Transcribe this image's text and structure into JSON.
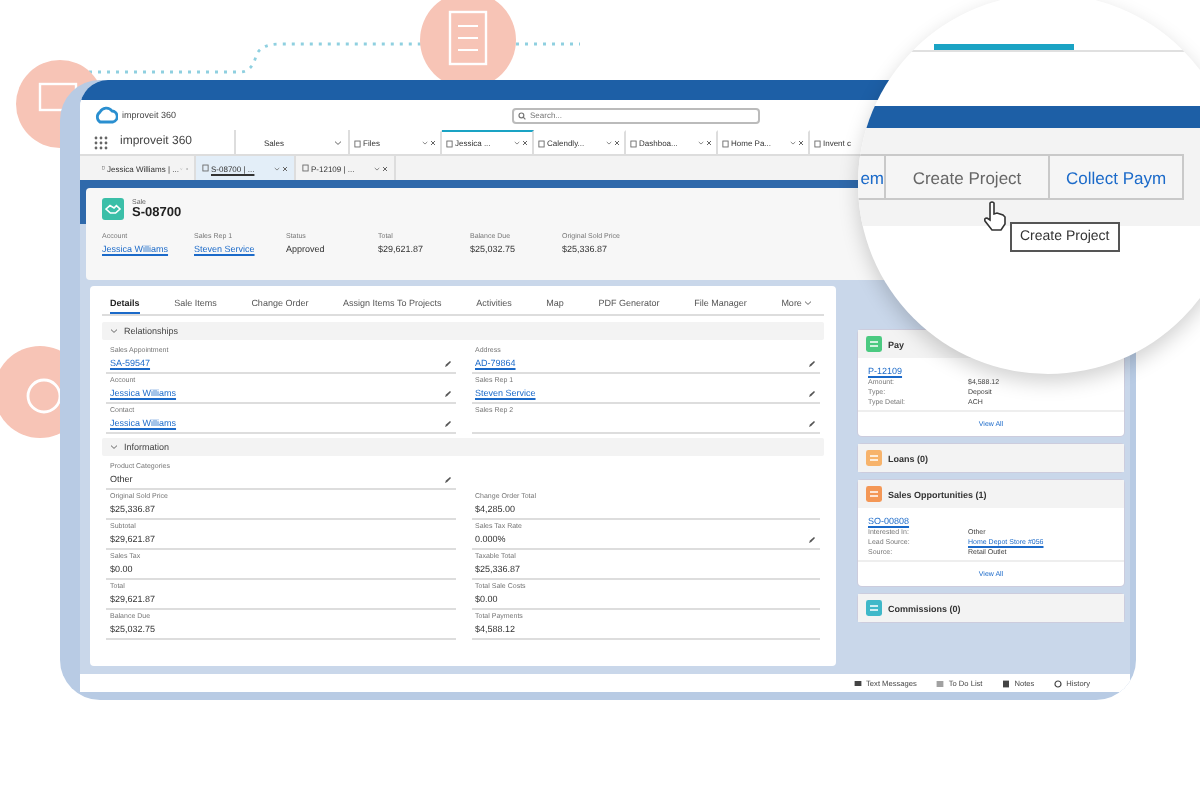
{
  "app": {
    "logo_text": "improveit 360",
    "search": {
      "placeholder": "Search..."
    },
    "app_name": "improveit 360",
    "nav_menu": "Sales"
  },
  "nav_tabs": [
    {
      "label": "Files",
      "selected": false
    },
    {
      "label": "Jessica ...",
      "selected": true
    },
    {
      "label": "Calendly...",
      "selected": false
    },
    {
      "label": "Dashboa...",
      "selected": false
    },
    {
      "label": "Home Pa...",
      "selected": false
    },
    {
      "label": "Invent c",
      "selected": false
    }
  ],
  "sub_tabs": [
    {
      "label": "Jessica Williams | ...",
      "selected": false
    },
    {
      "label": "S-08700 | ...",
      "selected": true
    },
    {
      "label": "P-12109 | ...",
      "selected": false
    }
  ],
  "record": {
    "type": "Sale",
    "name": "S-08700",
    "fields": [
      {
        "label": "Account",
        "value": "Jessica Williams",
        "link": true
      },
      {
        "label": "Sales Rep 1",
        "value": "Steven Service",
        "link": true
      },
      {
        "label": "Status",
        "value": "Approved",
        "link": false
      },
      {
        "label": "Total",
        "value": "$29,621.87",
        "link": false
      },
      {
        "label": "Balance Due",
        "value": "$25,032.75",
        "link": false
      },
      {
        "label": "Original Sold Price",
        "value": "$25,336.87",
        "link": false
      }
    ]
  },
  "detail_tabs": [
    {
      "label": "Details",
      "selected": true
    },
    {
      "label": "Sale Items",
      "selected": false
    },
    {
      "label": "Change Order",
      "selected": false
    },
    {
      "label": "Assign Items To Projects",
      "selected": false
    },
    {
      "label": "Activities",
      "selected": false
    },
    {
      "label": "Map",
      "selected": false
    },
    {
      "label": "PDF Generator",
      "selected": false
    },
    {
      "label": "File Manager",
      "selected": false
    }
  ],
  "more_tab": "More",
  "sections": [
    {
      "title": "Relationships",
      "expanded": true,
      "rows": [
        {
          "left": {
            "label": "Sales Appointment",
            "value": "SA-59547",
            "link": true,
            "editable": true
          },
          "right": {
            "label": "Address",
            "value": "AD-79864",
            "link": true,
            "editable": true
          }
        },
        {
          "left": {
            "label": "Account",
            "value": "Jessica Williams",
            "link": true,
            "editable": true
          },
          "right": {
            "label": "Sales Rep 1",
            "value": "Steven Service",
            "link": true,
            "editable": true
          }
        },
        {
          "left": {
            "label": "Contact",
            "value": "Jessica Williams",
            "link": true,
            "editable": true
          },
          "right": {
            "label": "Sales Rep 2",
            "editable": true
          }
        }
      ]
    },
    {
      "title": "Information",
      "expanded": true,
      "rows": [
        {
          "left": {
            "label": "Product Categories",
            "value": "Other",
            "link": false,
            "editable": true
          }
        },
        {
          "left": {
            "label": "Original Sold Price",
            "value": "$25,336.87",
            "link": false,
            "editable": false
          },
          "right": {
            "label": "Change Order Total",
            "value": "$4,285.00",
            "link": false,
            "editable": false
          }
        },
        {
          "left": {
            "label": "Subtotal",
            "value": "$29,621.87",
            "link": false,
            "editable": false
          },
          "right": {
            "label": "Sales Tax Rate",
            "value": "0.000%",
            "link": false,
            "editable": true
          }
        },
        {
          "left": {
            "label": "Sales Tax",
            "value": "$0.00",
            "link": false,
            "editable": false
          },
          "right": {
            "label": "Taxable Total",
            "value": "$25,336.87",
            "link": false,
            "editable": false
          }
        },
        {
          "left": {
            "label": "Total",
            "value": "$29,621.87",
            "link": false,
            "editable": false
          },
          "right": {
            "label": "Total Sale Costs",
            "value": "$0.00",
            "link": false,
            "editable": false
          }
        },
        {
          "left": {
            "label": "Balance Due",
            "value": "$25,032.75",
            "link": false,
            "editable": false
          },
          "right": {
            "label": "Total Payments",
            "value": "$4,588.12",
            "link": false,
            "editable": false
          }
        }
      ]
    }
  ],
  "side_cards": [
    {
      "title": "Pay",
      "color": "#4bca81",
      "record": "P-12109",
      "fields": [
        {
          "label": "Amount:",
          "value": "$4,588.12",
          "link": false
        },
        {
          "label": "Type:",
          "value": "Deposit",
          "link": false
        },
        {
          "label": "Type Detail:",
          "value": "ACH",
          "link": false
        }
      ],
      "footer": "View All"
    },
    {
      "title": "Loans (0)",
      "color": "#f7b36b"
    },
    {
      "title": "Sales Opportunities (1)",
      "color": "#f49756",
      "record": "SO-00808",
      "fields": [
        {
          "label": "Interested In:",
          "value": "Other",
          "link": false
        },
        {
          "label": "Lead Source:",
          "value": "Home Depot Store #056",
          "link": true
        },
        {
          "label": "Source:",
          "value": "Retail Outlet",
          "link": false
        }
      ],
      "footer": "View All"
    },
    {
      "title": "Commissions (0)",
      "color": "#3fb8c9"
    }
  ],
  "utility_bar": [
    {
      "label": "Text Messages",
      "kind": "messages"
    },
    {
      "label": "To Do List",
      "kind": "todo"
    },
    {
      "label": "Notes",
      "kind": "notes"
    },
    {
      "label": "History",
      "kind": "history"
    }
  ],
  "magnifier": {
    "buttons": [
      {
        "label": "em",
        "hovered": false
      },
      {
        "label": "Create Project",
        "hovered": true
      },
      {
        "label": "Collect Paym",
        "hovered": false
      }
    ],
    "tooltip": "Create Project"
  }
}
